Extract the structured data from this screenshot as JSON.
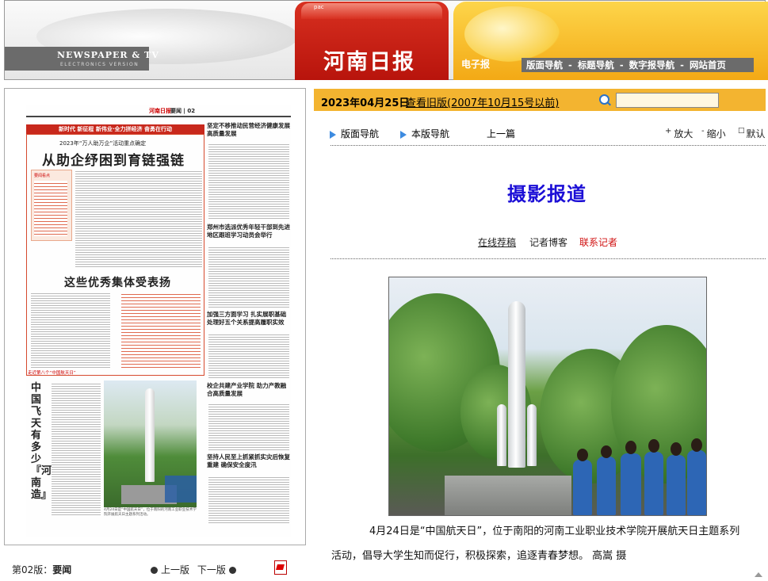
{
  "header": {
    "en_title": "NEWSPAPER & TV",
    "en_sub": "ELECTRONICS VERSION",
    "pac": "pac",
    "title": "河南日报",
    "subtitle": "电子报",
    "nav": [
      "版面导航",
      "标题导航",
      "数字报导航",
      "网站首页"
    ],
    "nav_sep": "-"
  },
  "paper_preview": {
    "logo": "河南日报",
    "section": "要闻 | 02",
    "band": "新时代 新征程 新伟业·全力拼经济 奋勇在行动",
    "kicker": "2023年“万人助万企”活动重点确定",
    "headline": "从助企纾困到育链强链",
    "box_head": "要闻看点",
    "headline2": "这些优秀集体受表扬",
    "side_titles": [
      "坚定不移推动民营经济健康发展高质量发展",
      "郑州市选派优秀年轻干部到先进地区跟班学习动员会举行",
      "加强三方面学习 扎实展职基础 处理好五个关系提高履职实效",
      "校企共建产业学院 助力产教融合高质量发展",
      "坚持人民至上抓紧抓实灾后恢复重建 确保安全度汛"
    ],
    "tag": "走近第八个“中国航天日”",
    "vertical_title": "中国飞天有多少『河南造』",
    "photo_caption": "4月24日是“中国航天日”，位于南阳的河南工业职业技术学院开展航天日主题系列活动。"
  },
  "left_footer": {
    "page_label": "第02版：",
    "page_name": "要闻",
    "prev": "上一版",
    "next": "下一版"
  },
  "toolbar": {
    "date": "2023年04月25日",
    "old_version": "查看旧版(2007年10月15号以前)",
    "search_value": ""
  },
  "nav2": {
    "layout_nav": "版面导航",
    "this_page_nav": "本版导航",
    "prev_article": "上一篇",
    "zoom_in": "放大",
    "zoom_out": "缩小",
    "default": "默认",
    "zoom_in_mark": "+",
    "zoom_out_mark": "-",
    "default_mark": "□"
  },
  "article": {
    "section_title": "摄影报道",
    "links": [
      "在线荐稿",
      "记者博客",
      "联系记者"
    ],
    "caption_line1": "4月24日是“中国航天日”，位于南阳的河南工业职业技术学院开展航天日主题系列",
    "caption_line2": "活动，倡导大学生知而促行，积极探索，追逐青春梦想。 高嵩 摄"
  },
  "colors": {
    "brand_red": "#c8281c",
    "date_bar": "#f3b430",
    "section_blue": "#1b0ed6",
    "contact_red": "#d01010"
  }
}
